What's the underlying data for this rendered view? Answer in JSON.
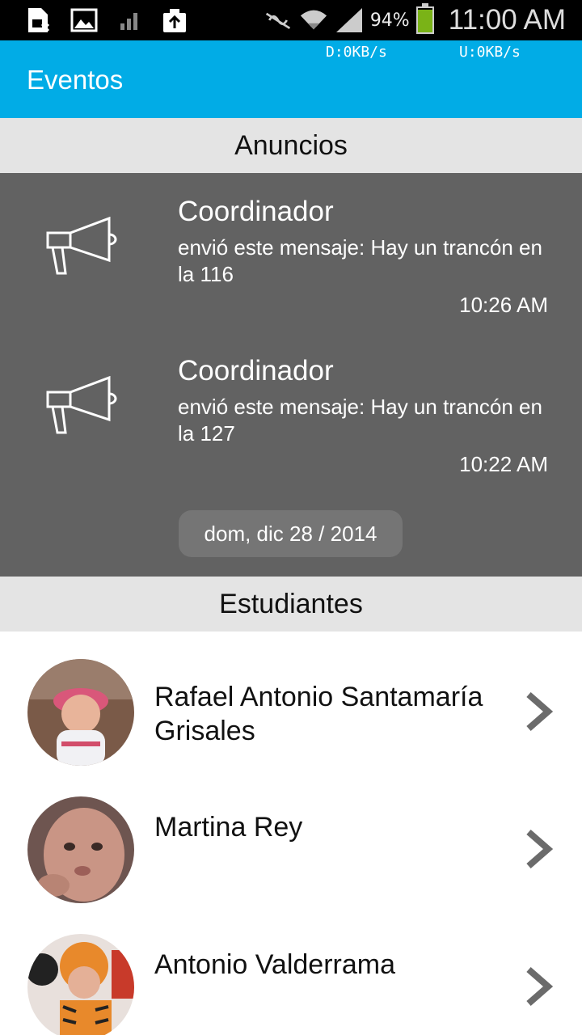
{
  "status_bar": {
    "battery_percent": "94%",
    "battery_level": 0.94,
    "clock": "11:00 AM",
    "left_icons": [
      "sim-card-error-icon",
      "image-icon",
      "signal-small-icon",
      "clipboard-upload-icon"
    ],
    "right_icons": [
      "nfc-muted-icon",
      "wifi-icon",
      "cell-signal-icon",
      "battery-icon"
    ]
  },
  "app_bar": {
    "title": "Eventos",
    "download_speed": "D:0KB/s",
    "upload_speed": "U:0KB/s",
    "color": "#01ace6"
  },
  "announcements_section": {
    "header": "Anuncios",
    "background": "#626262",
    "items": [
      {
        "sender": "Coordinador",
        "message": "envió este mensaje: Hay un trancón en la 116",
        "time": "10:26 AM",
        "icon": "megaphone-icon"
      },
      {
        "sender": "Coordinador",
        "message": "envió este mensaje: Hay un trancón en la 127",
        "time": "10:22 AM",
        "icon": "megaphone-icon"
      }
    ],
    "date_label": "dom, dic 28 / 2014"
  },
  "students_section": {
    "header": "Estudiantes",
    "items": [
      {
        "name": "Rafael Antonio Santamaría Grisales",
        "avatar": "baby-pink-hat-photo"
      },
      {
        "name": "Martina Rey",
        "avatar": "baby-face-photo"
      },
      {
        "name": "Antonio Valderrama",
        "avatar": "child-tiger-costume-photo"
      }
    ]
  }
}
